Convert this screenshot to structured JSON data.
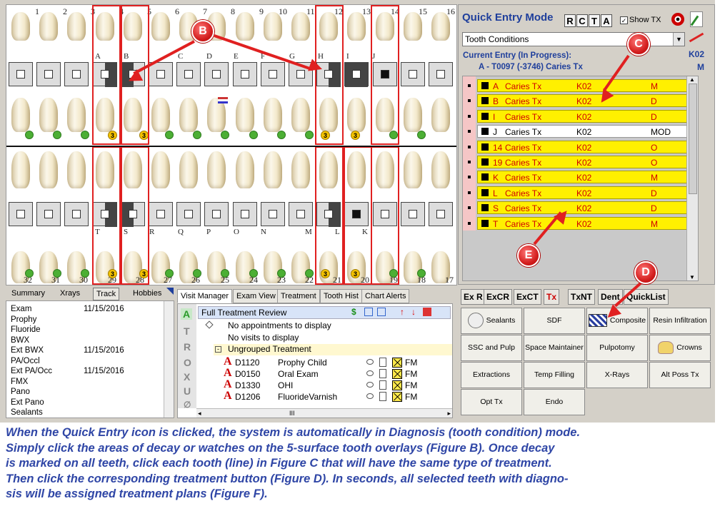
{
  "chart": {
    "upper_numbers": [
      "1",
      "2",
      "3",
      "4",
      "5",
      "6",
      "7",
      "8",
      "9",
      "10",
      "11",
      "12",
      "13",
      "14",
      "15",
      "16"
    ],
    "lower_numbers": [
      "32",
      "31",
      "30",
      "29",
      "28",
      "27",
      "26",
      "25",
      "24",
      "23",
      "22",
      "21",
      "20",
      "19",
      "18",
      "17"
    ],
    "upper_letters": [
      "A",
      "B",
      "C",
      "D",
      "E",
      "F",
      "G",
      "H",
      "I",
      "J"
    ],
    "lower_letters": [
      "T",
      "S",
      "R",
      "Q",
      "P",
      "O",
      "N",
      "M",
      "L",
      "K"
    ],
    "decay_badge": "3"
  },
  "summary": {
    "tabs": [
      "Summary",
      "Xrays",
      "Track",
      "Hobbies"
    ],
    "rows": [
      {
        "name": "Exam",
        "date": "11/15/2016"
      },
      {
        "name": "Prophy",
        "date": ""
      },
      {
        "name": "Fluoride",
        "date": ""
      },
      {
        "name": "BWX",
        "date": ""
      },
      {
        "name": "Ext BWX",
        "date": "11/15/2016"
      },
      {
        "name": "PA/Occl",
        "date": ""
      },
      {
        "name": "Ext PA/Occ",
        "date": "11/15/2016"
      },
      {
        "name": "FMX",
        "date": ""
      },
      {
        "name": "Pano",
        "date": ""
      },
      {
        "name": "Ext Pano",
        "date": ""
      },
      {
        "name": "Sealants",
        "date": ""
      }
    ]
  },
  "visit": {
    "tabs": [
      "Visit Manager",
      "Exam View",
      "Treatment",
      "Tooth Hist",
      "Chart Alerts"
    ],
    "header": "Full Treatment Review",
    "side_letters": [
      "A",
      "T",
      "R",
      "O",
      "X",
      "U"
    ],
    "no_appts": "No appointments to display",
    "no_visits": "No visits to display",
    "ungrouped": "Ungrouped Treatment",
    "items": [
      {
        "code": "D1120",
        "desc": "Prophy Child",
        "fm": "FM"
      },
      {
        "code": "D0150",
        "desc": "Oral Exam",
        "fm": "FM"
      },
      {
        "code": "D1330",
        "desc": "OHI",
        "fm": "FM"
      },
      {
        "code": "D1206",
        "desc": "FluorideVarnish",
        "fm": "FM"
      }
    ],
    "scroll_mark": "III"
  },
  "quick_entry": {
    "title": "Quick Entry Mode",
    "mode_buttons": [
      "R",
      "C",
      "T",
      "A"
    ],
    "show_tx_label": "Show TX",
    "show_tx_checked": "✓",
    "dropdown_value": "Tooth Conditions",
    "current_label": "Current Entry (In Progress):",
    "current_code": "K02",
    "current_line": "A - T0097  (-3746)   Caries Tx",
    "current_surface": "M",
    "rows": [
      {
        "tooth": "A",
        "name": "Caries Tx",
        "code": "K02",
        "surf": "M",
        "hl": true
      },
      {
        "tooth": "B",
        "name": "Caries Tx",
        "code": "K02",
        "surf": "D",
        "hl": true
      },
      {
        "tooth": "I",
        "name": "Caries Tx",
        "code": "K02",
        "surf": "D",
        "hl": true
      },
      {
        "tooth": "J",
        "name": "Caries Tx",
        "code": "K02",
        "surf": "MOD",
        "hl": false
      },
      {
        "tooth": "14",
        "name": "Caries Tx",
        "code": "K02",
        "surf": "O",
        "hl": true
      },
      {
        "tooth": "19",
        "name": "Caries Tx",
        "code": "K02",
        "surf": "O",
        "hl": true
      },
      {
        "tooth": "K",
        "name": "Caries Tx",
        "code": "K02",
        "surf": "M",
        "hl": true
      },
      {
        "tooth": "L",
        "name": "Caries Tx",
        "code": "K02",
        "surf": "D",
        "hl": true
      },
      {
        "tooth": "S",
        "name": "Caries Tx",
        "code": "K02",
        "surf": "D",
        "hl": true
      },
      {
        "tooth": "T",
        "name": "Caries Tx",
        "code": "K02",
        "surf": "M",
        "hl": true
      }
    ]
  },
  "tx_buttons": {
    "tabs": [
      "Ex R",
      "ExCR",
      "ExCT",
      "Tx",
      "TxNT",
      "Dent",
      "QuickList"
    ],
    "buttons": [
      [
        "Sealants",
        "SDF",
        "Composite",
        "Resin Infiltration"
      ],
      [
        "SSC and Pulp",
        "Space Maintainer",
        "Pulpotomy",
        "Crowns"
      ],
      [
        "Extractions",
        "Temp Filling",
        "X-Rays",
        "Alt Poss Tx"
      ],
      [
        "Opt Tx",
        "Endo",
        "",
        ""
      ]
    ]
  },
  "callouts": {
    "b": "B",
    "c": "C",
    "d": "D",
    "e": "E"
  },
  "caption": [
    "When the Quick Entry icon is clicked, the system is automatically in Diagnosis (tooth condition) mode.",
    "Simply click the areas of decay or watches on the 5-surface tooth overlays (Figure B).  Once decay",
    "is marked on all teeth, click each tooth (line) in Figure C that will have the same type of treatment.",
    "Then click the corresponding treatment button (Figure D).  In seconds, all selected teeth with diagno-",
    "sis will be assigned treatment plans (Figure F)."
  ],
  "colors": {
    "accent": "#1f3f9c",
    "highlight": "#fff000",
    "alert": "#e02020",
    "caption": "#2f46a6"
  }
}
